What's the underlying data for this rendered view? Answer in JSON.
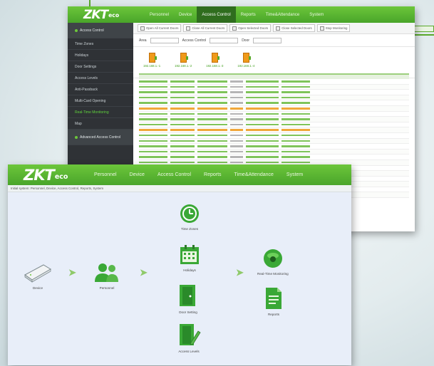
{
  "colors": {
    "brand_green": "#5aa92b",
    "nav_green": "#4aa52b",
    "sidebar_dark": "#2f3236",
    "door_orange": "#f09a1a"
  },
  "back_window": {
    "logo": "ZKTeco",
    "nav_tabs": [
      "Personnel",
      "Device",
      "Access Control",
      "Reports",
      "Time&Attendance",
      "System"
    ],
    "active_tab": "Access Control",
    "sidebar": {
      "header": "Access Control",
      "items": [
        "Time Zones",
        "Holidays",
        "Door Settings",
        "Access Levels",
        "Anti-Passback",
        "Multi-Card Opening",
        "Real-Time Monitoring",
        "Map",
        "Advanced Access Control"
      ],
      "active_item": "Real-Time Monitoring"
    },
    "toolbar": [
      "Open All Current Doors",
      "Close All Current Doors",
      "Open Selected Doors",
      "Close Selected Doors",
      "Stop Monitoring"
    ],
    "filters": [
      "Area",
      "Access Control",
      "Door"
    ],
    "doors": [
      "192.168.1.-1",
      "192.168.1.-2",
      "192.168.1.-3",
      "192.168.1.-4"
    ]
  },
  "front_window": {
    "logo": "ZKTeco",
    "nav_tabs": [
      "Personnel",
      "Device",
      "Access Control",
      "Reports",
      "Time&Attendance",
      "System"
    ],
    "breadcrumb": "Initial system: Personnel, Device, Access Control, Reports, System",
    "nodes": {
      "device": "Device",
      "personnel": "Personnel",
      "time_zones": "Time Zones",
      "holidays": "Holidays",
      "door_setting": "Door Setting",
      "access_levels": "Access Levels",
      "monitoring": "Real-Time Monitoring",
      "reports": "Reports"
    }
  }
}
